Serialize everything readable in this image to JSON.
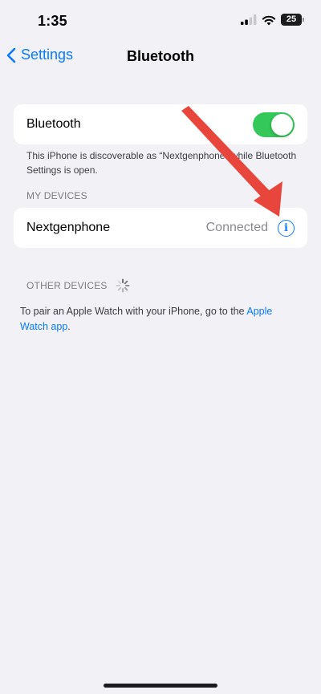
{
  "status_bar": {
    "time": "1:35",
    "battery": "25"
  },
  "nav": {
    "back_label": "Settings",
    "title": "Bluetooth"
  },
  "bluetooth": {
    "label": "Bluetooth",
    "enabled": true,
    "discoverable_note": "This iPhone is discoverable as “Nextgenphone” while Bluetooth Settings is open."
  },
  "my_devices": {
    "header": "MY DEVICES",
    "devices": [
      {
        "name": "Nextgenphone",
        "status": "Connected"
      }
    ]
  },
  "other_devices": {
    "header": "OTHER DEVICES"
  },
  "pair_note": {
    "text": "To pair an Apple Watch with your iPhone, go to the ",
    "link": "Apple Watch app",
    "end": "."
  },
  "colors": {
    "accent": "#0a7aff",
    "toggle_on": "#34c759",
    "annotation_arrow": "#e8463d",
    "background": "#f2f1f6"
  }
}
